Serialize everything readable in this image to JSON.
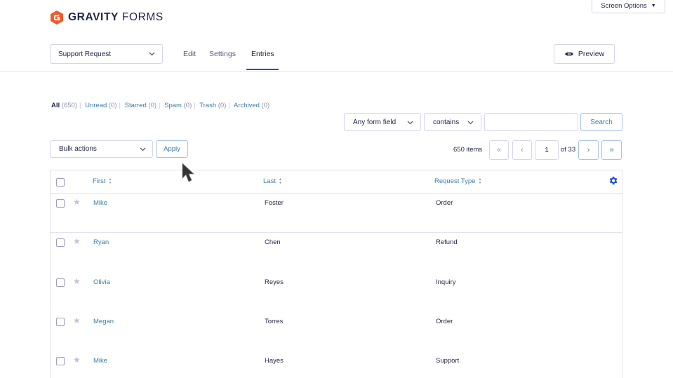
{
  "brand": {
    "name_bold": "GRAVITY",
    "name_light": "FORMS",
    "color": "#f15a2b"
  },
  "screen_options": {
    "label": "Screen Options",
    "icon": "caret-down-icon"
  },
  "form_selector": {
    "value": "Support Request",
    "icon": "chevron-down-icon"
  },
  "tabs": [
    {
      "label": "Edit"
    },
    {
      "label": "Settings"
    },
    {
      "label": "Entries",
      "active": true
    }
  ],
  "preview": {
    "label": "Preview",
    "icon": "eye-icon"
  },
  "views": [
    {
      "label": "All",
      "count": "(650)",
      "current": true
    },
    {
      "label": "Unread",
      "count": "(0)"
    },
    {
      "label": "Starred",
      "count": "(0)"
    },
    {
      "label": "Spam",
      "count": "(0)"
    },
    {
      "label": "Trash",
      "count": "(0)"
    },
    {
      "label": "Archived",
      "count": "(0)"
    }
  ],
  "search": {
    "field": "Any form field",
    "operator": "contains",
    "value": "",
    "button": "Search"
  },
  "bulk": {
    "value": "Bulk actions",
    "apply": "Apply"
  },
  "pagination": {
    "items": "650 items",
    "first": "«",
    "prev": "‹",
    "current": "1",
    "of": "of 33",
    "next": "›",
    "last": "»"
  },
  "table": {
    "columns": [
      "First",
      "Last",
      "Request Type"
    ],
    "settings_icon": "gear-icon",
    "rows": [
      {
        "first": "Mike",
        "last": "Foster",
        "type": "Order",
        "starred": false
      },
      {
        "first": "Ryan",
        "last": "Chen",
        "type": "Refund",
        "starred": false
      },
      {
        "first": "Olivia",
        "last": "Reyes",
        "type": "Inquiry",
        "starred": false
      },
      {
        "first": "Megan",
        "last": "Torres",
        "type": "Order",
        "starred": false
      },
      {
        "first": "Mike",
        "last": "Hayes",
        "type": "Support",
        "starred": false
      }
    ]
  },
  "colors": {
    "accent": "#204ce5",
    "link": "#3e7da6",
    "text": "#242748"
  }
}
